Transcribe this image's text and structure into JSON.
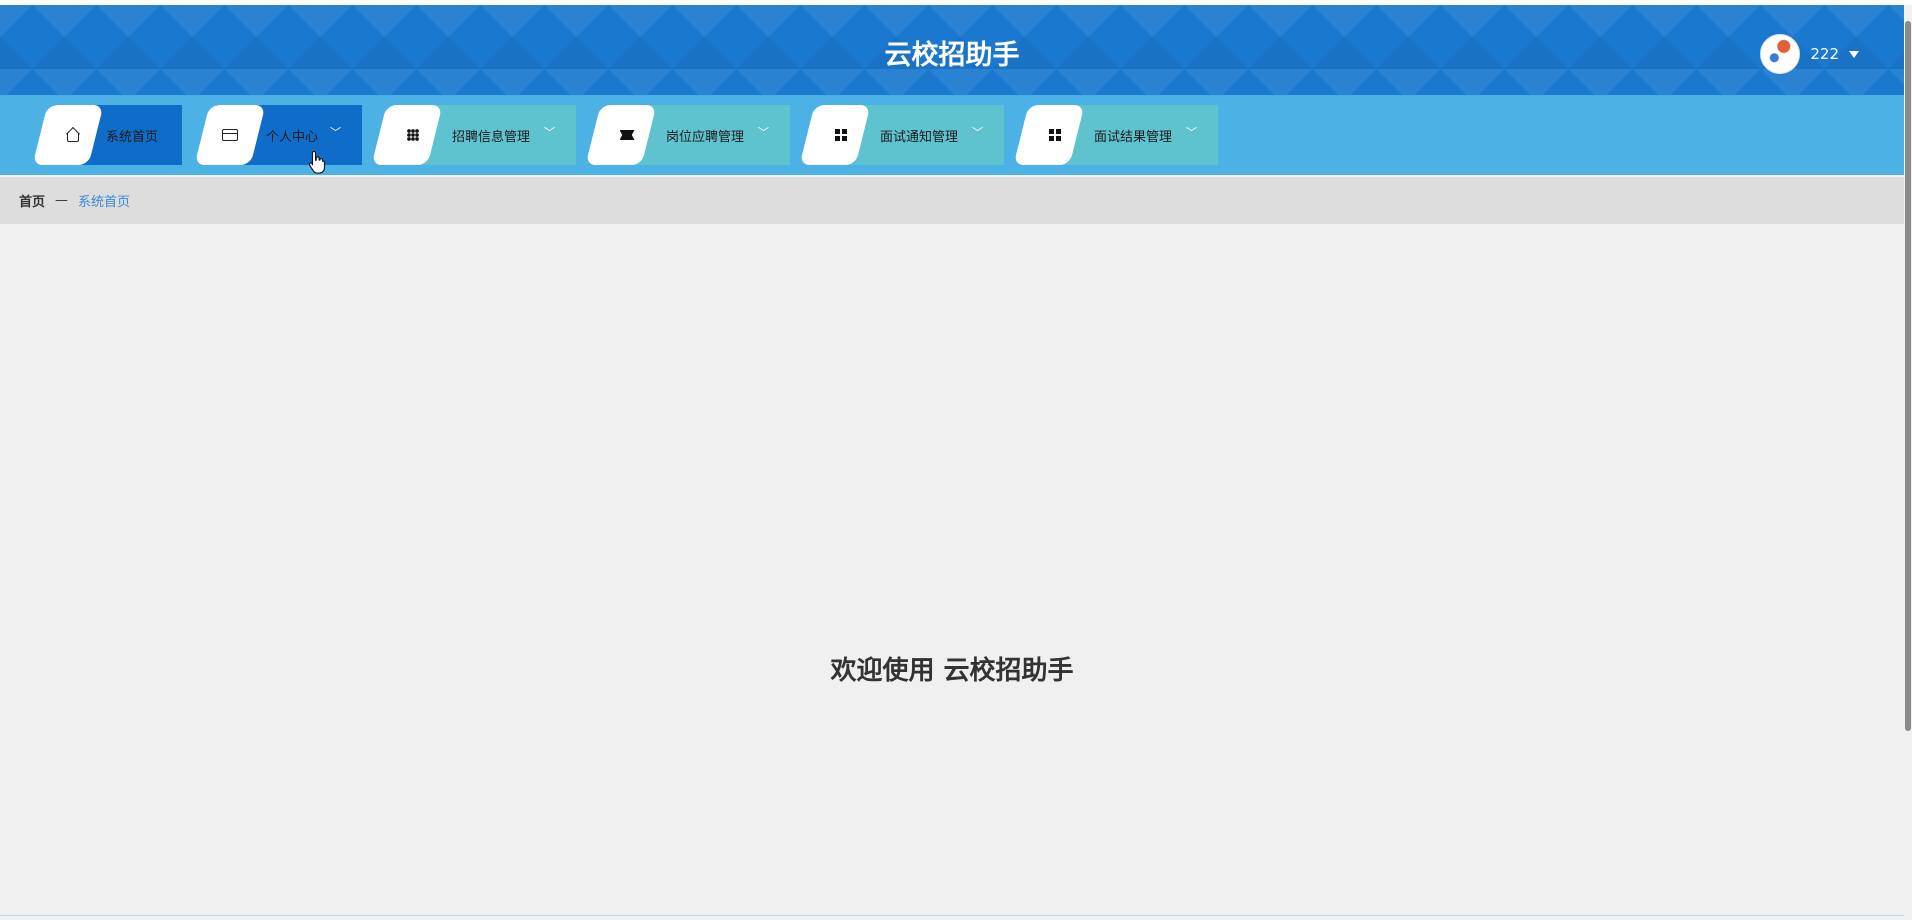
{
  "header": {
    "title": "云校招助手",
    "user": {
      "name": "222"
    }
  },
  "nav": {
    "items": [
      {
        "label": "系统首页",
        "icon": "home-icon",
        "dropdown": false,
        "active": true
      },
      {
        "label": "个人中心",
        "icon": "wallet-icon",
        "dropdown": true,
        "active": true
      },
      {
        "label": "招聘信息管理",
        "icon": "grid-icon",
        "dropdown": true,
        "active": false
      },
      {
        "label": "岗位应聘管理",
        "icon": "ticket-icon",
        "dropdown": true,
        "active": false
      },
      {
        "label": "面试通知管理",
        "icon": "apps-icon",
        "dropdown": true,
        "active": false
      },
      {
        "label": "面试结果管理",
        "icon": "apps-icon",
        "dropdown": true,
        "active": false
      }
    ]
  },
  "breadcrumb": {
    "home": "首页",
    "separator": "—",
    "current": "系统首页"
  },
  "main": {
    "welcome": "欢迎使用 云校招助手"
  },
  "colors": {
    "header_bg": "#1a78cf",
    "nav_bg": "#4cb2e6",
    "nav_active_bg": "#0f6cc8",
    "nav_inactive_bg": "#5fc3cf",
    "breadcrumb_bg": "#dddddd",
    "breadcrumb_current": "#3a87d8",
    "page_bg": "#f0f0f0"
  }
}
